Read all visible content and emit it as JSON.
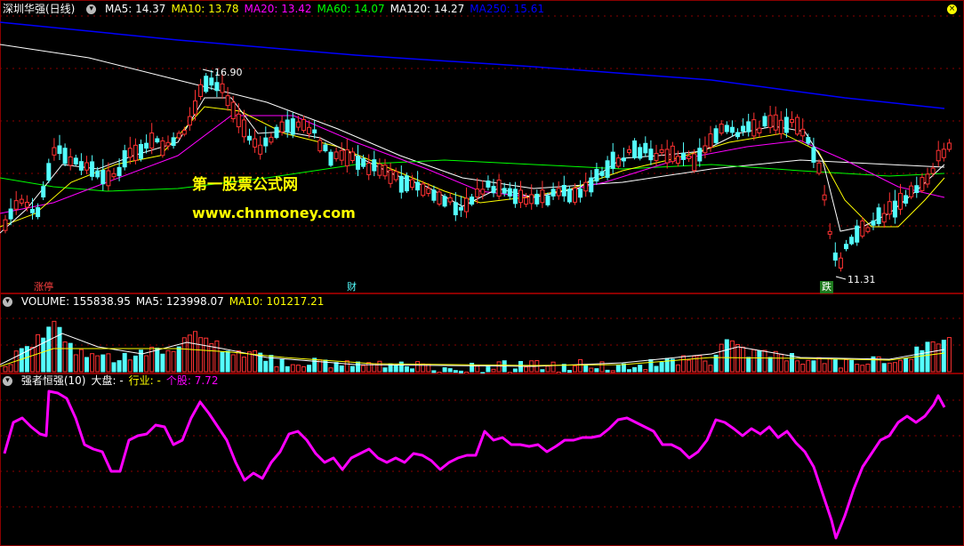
{
  "main_panel": {
    "title": "深圳华强(日线)",
    "ma_labels": [
      {
        "text": "MA5: 14.37",
        "color": "#ffffff"
      },
      {
        "text": "MA10: 13.78",
        "color": "#ffff00"
      },
      {
        "text": "MA20: 13.42",
        "color": "#ff00ff"
      },
      {
        "text": "MA60: 14.07",
        "color": "#00ff00"
      },
      {
        "text": "MA120: 14.27",
        "color": "#ffffff"
      },
      {
        "text": "MA250: 15.61",
        "color": "#0000ff"
      }
    ],
    "high_price_label": "16.90",
    "low_price_label": "11.31",
    "markers": {
      "zt": "涨停",
      "cai": "财",
      "die": "跌"
    },
    "watermark_title": "第一股票公式网",
    "watermark_url": "www.chnmoney.com"
  },
  "volume_panel": {
    "labels": [
      {
        "text": "VOLUME: 155838.95",
        "color": "#ffffff"
      },
      {
        "text": "MA5: 123998.07",
        "color": "#ffffff"
      },
      {
        "text": "MA10: 101217.21",
        "color": "#ffff00"
      }
    ]
  },
  "indicator_panel": {
    "labels": [
      {
        "text": "强者恒强(10)",
        "color": "#ffffff"
      },
      {
        "text": "大盘: -",
        "color": "#ffffff"
      },
      {
        "text": "行业: -",
        "color": "#ffff00"
      },
      {
        "text": "个股: 7.72",
        "color": "#ff00ff"
      }
    ]
  },
  "colors": {
    "up": "#ff3232",
    "down": "#54ffff",
    "ma5": "#ffffff",
    "ma10": "#ffff00",
    "ma20": "#ff00ff",
    "ma60": "#00ff00",
    "ma120": "#ffffff",
    "ma250": "#0000ff",
    "indicator": "#ff00ff"
  },
  "icons": {
    "menu_icon": "circle-arrow-down",
    "close_icon": "yellow-circle"
  }
}
